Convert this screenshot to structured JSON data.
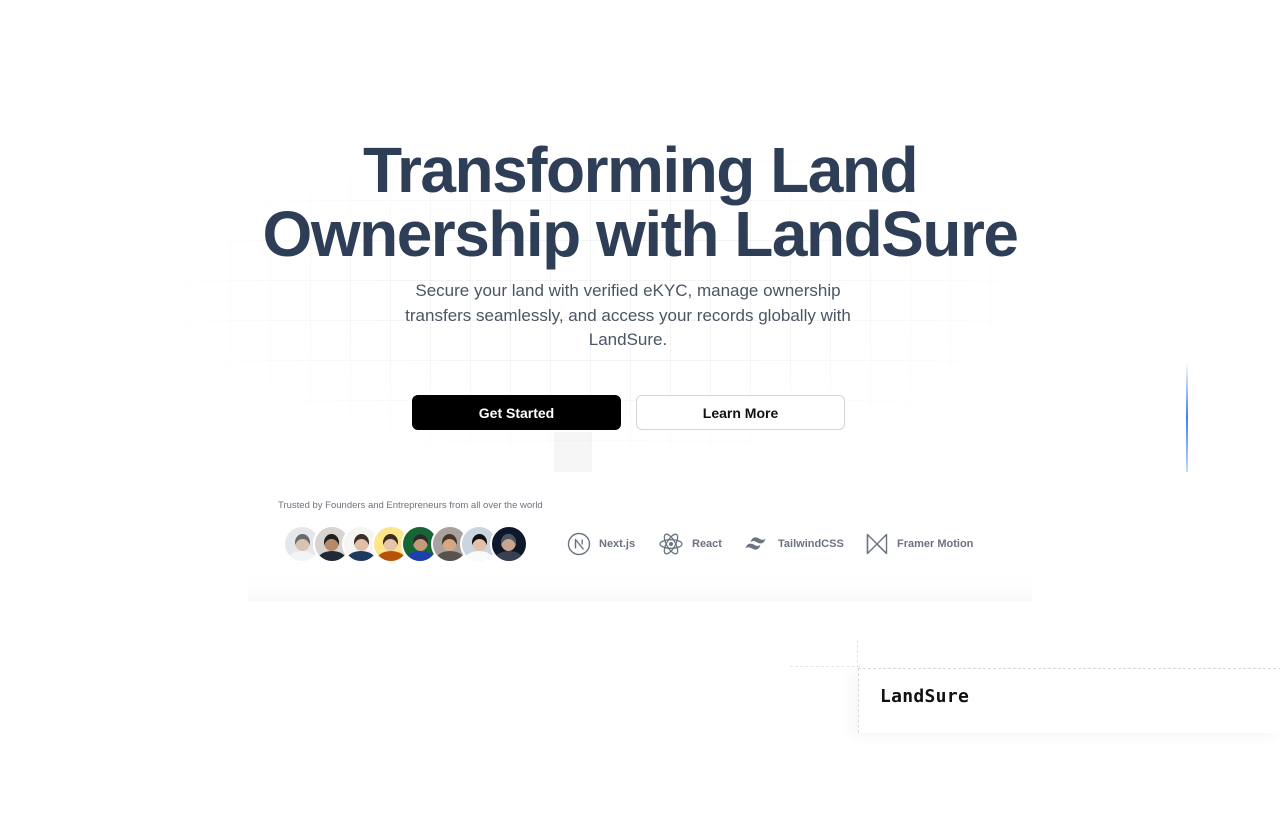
{
  "hero": {
    "headline_line1": "Transforming Land",
    "headline_line2": "Ownership with LandSure",
    "subtitle": "Secure your land with verified eKYC, manage ownership transfers seamlessly, and access your records globally with LandSure.",
    "primary_button": "Get Started",
    "secondary_button": "Learn More"
  },
  "trusted": {
    "text": "Trusted by Founders and Entrepreneurs from all over the world",
    "avatars": [
      {
        "skin": "#d8c2b0",
        "hair": "#6b6b6b",
        "bg": "#e5e7eb",
        "shirt": "#f3f4f6"
      },
      {
        "skin": "#b98a6a",
        "hair": "#1f1f1f",
        "bg": "#d6d3d1",
        "shirt": "#1f2937"
      },
      {
        "skin": "#e0bfa6",
        "hair": "#3b2f2a",
        "bg": "#f5f5f4",
        "shirt": "#1e3a5f"
      },
      {
        "skin": "#e8c4a8",
        "hair": "#3f2a1e",
        "bg": "#fde68a",
        "shirt": "#b45309"
      },
      {
        "skin": "#c59a78",
        "hair": "#2b2b2b",
        "bg": "#166534",
        "shirt": "#1e40af"
      },
      {
        "skin": "#d4a885",
        "hair": "#4a3526",
        "bg": "#a8a29e",
        "shirt": "#57534e"
      },
      {
        "skin": "#e2c2a7",
        "hair": "#111111",
        "bg": "#cbd5e1",
        "shirt": "#f8fafc"
      },
      {
        "skin": "#c8a58c",
        "hair": "#4b5563",
        "bg": "#0f172a",
        "shirt": "#374151"
      }
    ]
  },
  "tech_stack": {
    "items": [
      {
        "label": "Next.js",
        "icon": "nextjs-icon"
      },
      {
        "label": "React",
        "icon": "react-icon"
      },
      {
        "label": "TailwindCSS",
        "icon": "tailwind-icon"
      },
      {
        "label": "Framer Motion",
        "icon": "framer-motion-icon"
      }
    ]
  },
  "footer_brand": {
    "name": "LandSure"
  },
  "colors": {
    "headline": "#2f3e57",
    "primary_button_bg": "#000000",
    "accent_line": "#3b82f6"
  }
}
